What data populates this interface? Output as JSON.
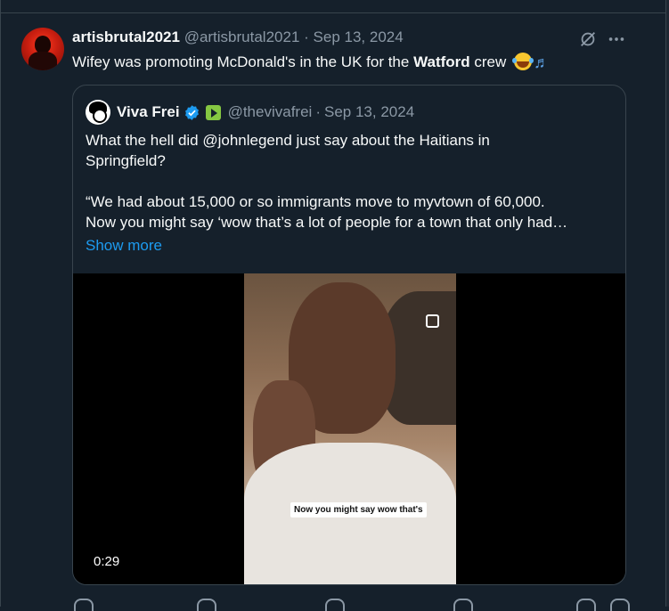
{
  "tweet": {
    "display_name": "artisbrutal2021",
    "handle": "@artisbrutal2021",
    "separator": "·",
    "date": "Sep 13, 2024",
    "text_before": "Wifey was promoting McDonald's in the UK for the ",
    "text_bold": "Watford",
    "text_after": " crew",
    "emojis": [
      "laughing-crying-icon",
      "music-notes-icon"
    ]
  },
  "quote": {
    "display_name": "Viva Frei",
    "handle": "@thevivafrei",
    "separator": "·",
    "date": "Sep 13, 2024",
    "para1_line1": "What the hell did @johnlegend just say about the Haitians in",
    "para1_line2": "Springfield?",
    "para2_line1": "“We had about 15,000 or so immigrants move to myvtown of 60,000.",
    "para2_line2": "Now you might say ‘wow that’s a lot of people for a town that only had…",
    "show_more": "Show more",
    "video": {
      "caption": "Now you might say wow that's",
      "duration": "0:29"
    }
  },
  "colors": {
    "background": "#15202b",
    "border": "#38444d",
    "secondary_text": "#8b98a5",
    "link": "#1d9bf0",
    "verified": "#1d9bf0"
  }
}
